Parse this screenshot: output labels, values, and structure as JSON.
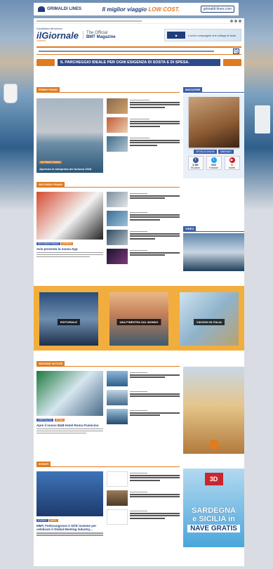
{
  "top_banner": {
    "brand": "GRIMALDI LINES",
    "slogan_prefix": "Il miglior viaggio ",
    "slogan_highlight": "LOW COST.",
    "site": "grimaldi-lines.com"
  },
  "header": {
    "logo_small": "il quotidiano del turismo",
    "logo_main": "ilGiornale",
    "logo_sub": "vacanze",
    "official_line1": "The Official",
    "official_line2": "BMT Magazine",
    "ad_text": "L'unico compagnia che collega le isole"
  },
  "parking": {
    "text": "IL PARCHEGGIO IDEALE PER OGNI ESIGENZA DI SOSTA E DI SPESA."
  },
  "sections": {
    "first": "PRIMO PIANO",
    "magazine": "MAGAZINE",
    "second": "SECONDO PIANO",
    "video": "VIDEO",
    "third": "SEZIONE NOTIZIE",
    "events": "EVENTI"
  },
  "primo_piano": {
    "main_tag": "IN PRIMO PIANO",
    "main_title": "Apertura in anteprima del turismo 2018"
  },
  "magazine": {
    "btn1": "SFOGLIA ONLINE",
    "btn2": "ABBONATI",
    "facebook_count": "3.5K",
    "facebook_label": "Mi piace",
    "twitter_count": "906",
    "twitter_label": "Follower",
    "youtube_count": "0",
    "youtube_label": "Iscritti"
  },
  "secondo_piano": {
    "main_title": "Avis presenta la nuova App",
    "tag1": "SECONDO PIANO",
    "tag2": "MOBILE"
  },
  "features": {
    "card1": "EDITORIALE",
    "card2": "UNA FINESTRA SUL MONDO",
    "card3": "VIAGGIO IN ITALIA"
  },
  "news": {
    "main_title": "Apre il nuovo B&B Hotel Roma Fiumicino",
    "tag1": "OSPITALITA'",
    "tag2": "ROMA"
  },
  "events": {
    "main_title": "MMT, Fedecongressi è SITE insieme per celebrare il Global Meeting Industry...",
    "tag1": "EVENTI",
    "tag2": "MICE"
  },
  "sardegna_ad": {
    "brand": "3D",
    "line1": "SARDEGNA",
    "line2": "e SICILIA in",
    "line3": "NAVE GRATIS"
  }
}
